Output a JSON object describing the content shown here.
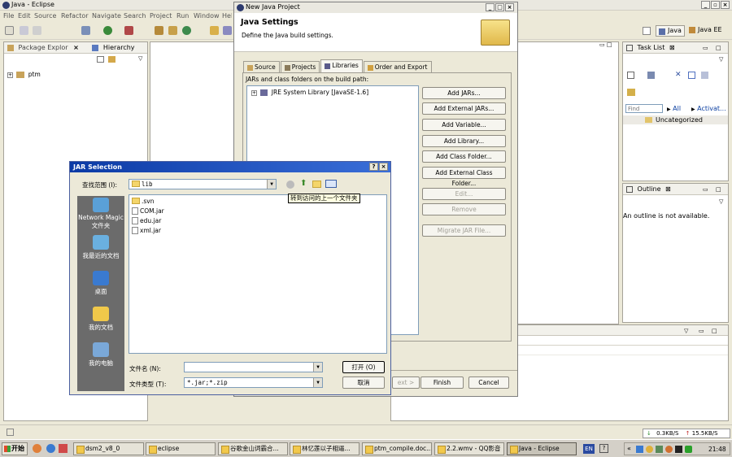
{
  "eclipse": {
    "title": "Java - Eclipse",
    "menu": [
      "File",
      "Edit",
      "Source",
      "Refactor",
      "Navigate",
      "Search",
      "Project",
      "Run",
      "Window",
      "Help"
    ],
    "perspectives": [
      "Java",
      "Java EE"
    ],
    "package_explorer": {
      "tab": "Package Explor",
      "tab2": "Hierarchy",
      "project": "ptm"
    },
    "task_list": {
      "tab": "Task List",
      "find_placeholder": "Find",
      "all": "All",
      "activate": "Activat...",
      "uncategorized": "Uncategorized"
    },
    "outline": {
      "tab": "Outline",
      "message": "An outline is not available."
    },
    "status_speed": {
      "down": "0.3KB/S",
      "up": "15.5KB/S"
    }
  },
  "new_project_dialog": {
    "title": "New Java Project",
    "header_title": "Java Settings",
    "header_desc": "Define the Java build settings.",
    "tabs": [
      "Source",
      "Projects",
      "Libraries",
      "Order and Export"
    ],
    "active_tab": "Libraries",
    "jar_label": "JARs and class folders on the build path:",
    "library": "JRE System Library [JavaSE-1.6]",
    "buttons": {
      "add_jars": "Add JARs...",
      "add_external_jars": "Add External JARs...",
      "add_variable": "Add Variable...",
      "add_library": "Add Library...",
      "add_class_folder": "Add Class Folder...",
      "add_external_class_folder": "Add External Class Folder...",
      "edit": "Edit...",
      "remove": "Remove",
      "migrate": "Migrate JAR File..."
    },
    "footer": {
      "next": "ext >",
      "finish": "Finish",
      "cancel": "Cancel"
    }
  },
  "jar_dialog": {
    "title": "JAR Selection",
    "look_in_label": "查找范围 (I):",
    "look_in_value": "lib",
    "tooltip": "转到访问的上一个文件夹",
    "places": [
      "Network Magic 文件夹",
      "我最近的文档",
      "桌面",
      "我的文档",
      "我的电脑"
    ],
    "files": [
      {
        "name": ".svn",
        "type": "folder"
      },
      {
        "name": "COM.jar",
        "type": "file"
      },
      {
        "name": "edu.jar",
        "type": "file"
      },
      {
        "name": "xml.jar",
        "type": "file"
      }
    ],
    "filename_label": "文件名 (N):",
    "filename_value": "",
    "filetype_label": "文件类型 (T):",
    "filetype_value": "*.jar;*.zip",
    "open": "打开 (O)",
    "cancel": "取消"
  },
  "taskbar": {
    "start": "开始",
    "items": [
      "dsm2_v8_0",
      "eclipse",
      "谷歌金山词霸合...",
      "林忆莲以子相逼...",
      "ptm_compile.doc...",
      "2.2.wmv - QQ影音",
      "Java - Eclipse"
    ],
    "active": "Java - Eclipse",
    "lang": "EN",
    "time": "21:48"
  }
}
